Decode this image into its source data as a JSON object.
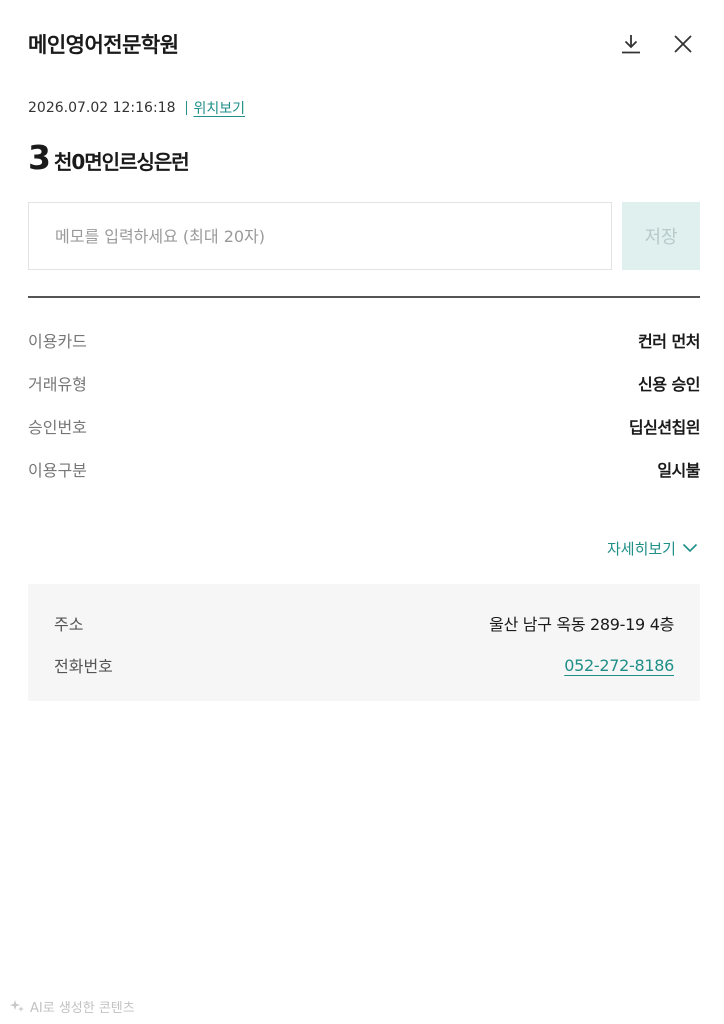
{
  "header": {
    "title": "메인영어전문학원",
    "download_icon": "download-icon",
    "close_icon": "close-icon"
  },
  "meta": {
    "datetime": "2026.07.02 12:16:18",
    "location_link": "위치보기"
  },
  "amount": {
    "number": "3",
    "text": "천0면인르싱은런"
  },
  "memo": {
    "placeholder": "메모를 입력하세요 (최대 20자)",
    "value": "",
    "save_label": "저장"
  },
  "details": [
    {
      "label": "이용카드",
      "value": "컨러 먼처"
    },
    {
      "label": "거래유형",
      "value": "신용 승인"
    },
    {
      "label": "승인번호",
      "value": "딥싣션칩읜"
    },
    {
      "label": "이용구분",
      "value": "일시불"
    }
  ],
  "detail_toggle": {
    "label": "자세히보기",
    "icon": "chevron-down-icon"
  },
  "store": {
    "address_label": "주소",
    "address_value": "울산 남구 옥동 289-19 4층",
    "phone_label": "전화번호",
    "phone_value": "052-272-8186"
  },
  "footer": {
    "ai_note": "AI로 생성한 콘텐츠",
    "ai_icon": "sparkle-icon"
  },
  "colors": {
    "accent": "#1f8f88",
    "save_bg": "#dff0ef",
    "panel_bg": "#f6f6f6"
  }
}
